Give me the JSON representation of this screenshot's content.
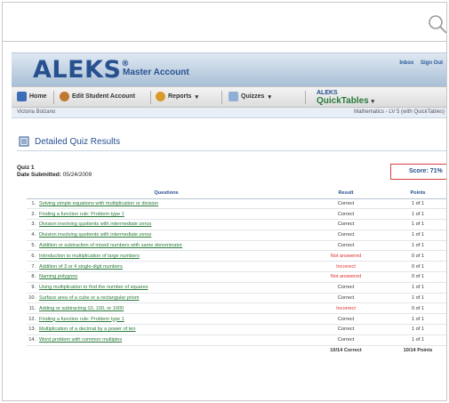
{
  "header": {
    "logo": "ALEKS",
    "logo_mark": "®",
    "account_label": "Master Account",
    "inbox_label": "Inbox",
    "signout_label": "Sign Out"
  },
  "nav": {
    "home": "Home",
    "edit_student": "Edit Student Account",
    "reports": "Reports",
    "quizzes": "Quizzes",
    "quicktables_top": "ALEKS",
    "quicktables_bottom": "QuickTables"
  },
  "subbar": {
    "student": "Victoria Bolzano",
    "course": "Mathematics - LV 5 (with QuickTables)"
  },
  "page": {
    "title": "Detailed Quiz Results",
    "quiz_name": "Quiz 1",
    "date_label": "Date Submitted:",
    "date_value": "05/24/2009",
    "score_label": "Score: 71%"
  },
  "table": {
    "headers": [
      "Questions",
      "Result",
      "Points"
    ],
    "rows": [
      {
        "n": "1.",
        "q": "Solving simple equations with multiplication or division",
        "r": "Correct",
        "p": "1 of 1"
      },
      {
        "n": "2.",
        "q": "Finding a function rule: Problem type 1",
        "r": "Correct",
        "p": "1 of 1"
      },
      {
        "n": "3.",
        "q": "Division involving quotients with intermediate zeros",
        "r": "Correct",
        "p": "1 of 1"
      },
      {
        "n": "4.",
        "q": "Division involving quotients with intermediate zeros",
        "r": "Correct",
        "p": "1 of 1"
      },
      {
        "n": "5.",
        "q": "Addition or subtraction of mixed numbers with same denominator",
        "r": "Correct",
        "p": "1 of 1"
      },
      {
        "n": "6.",
        "q": "Introduction to multiplication of large numbers",
        "r": "Not answered",
        "p": "0 of 1"
      },
      {
        "n": "7.",
        "q": "Addition of 3 or 4 single-digit numbers",
        "r": "Incorrect",
        "p": "0 of 1"
      },
      {
        "n": "8.",
        "q": "Naming polygons",
        "r": "Not answered",
        "p": "0 of 1"
      },
      {
        "n": "9.",
        "q": "Using multiplication to find the number of squares",
        "r": "Correct",
        "p": "1 of 1"
      },
      {
        "n": "10.",
        "q": "Surface area of a cube or a rectangular prism",
        "r": "Correct",
        "p": "1 of 1"
      },
      {
        "n": "11.",
        "q": "Adding or subtracting 10, 100, or 1000",
        "r": "Incorrect",
        "p": "0 of 1"
      },
      {
        "n": "12.",
        "q": "Finding a function rule: Problem type 1",
        "r": "Correct",
        "p": "1 of 1"
      },
      {
        "n": "13.",
        "q": "Multiplication of a decimal by a power of ten",
        "r": "Correct",
        "p": "1 of 1"
      },
      {
        "n": "14.",
        "q": "Word problem with common multiples",
        "r": "Correct",
        "p": "1 of 1"
      }
    ],
    "total_result": "10/14 Correct",
    "total_points": "10/14 Points"
  },
  "colors": {
    "brand": "#27508f",
    "link": "#2a7a3a",
    "error": "#e03030",
    "score_border": "#d94040"
  },
  "icons": [
    "zoom-icon",
    "home-icon",
    "user-icon",
    "reports-icon",
    "quizzes-icon",
    "chevron-down-icon",
    "page-icon"
  ]
}
